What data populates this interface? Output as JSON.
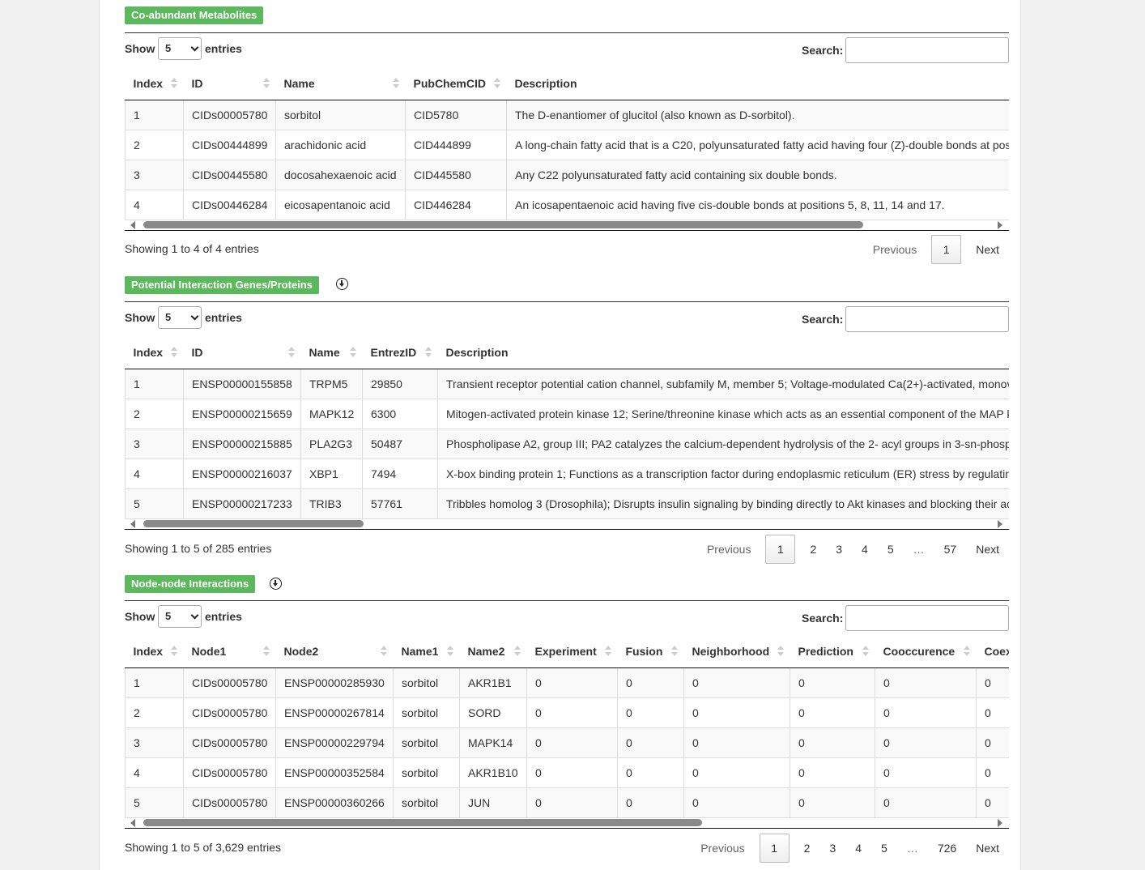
{
  "common": {
    "show_label": "Show",
    "entries_label": "entries",
    "page_size": "5",
    "search_label": "Search:",
    "previous": "Previous",
    "next": "Next"
  },
  "sections": {
    "metabolites": {
      "title": "Co-abundant Metabolites",
      "columns": [
        "Index",
        "ID",
        "Name",
        "PubChemCID",
        "Description"
      ],
      "rows": [
        [
          "1",
          "CIDs00005780",
          "sorbitol",
          "CID5780",
          "The D-enantiomer of glucitol (also known as D-sorbitol)."
        ],
        [
          "2",
          "CIDs00444899",
          "arachidonic acid",
          "CID444899",
          "A long-chain fatty acid that is a C20, polyunsaturated fatty acid having four (Z)-double bonds at pos"
        ],
        [
          "3",
          "CIDs00445580",
          "docosahexaenoic acid",
          "CID445580",
          "Any C22 polyunsaturated fatty acid containing six double bonds."
        ],
        [
          "4",
          "CIDs00446284",
          "eicosapentanoic acid",
          "CID446284",
          "An icosapentaenoic acid having five cis-double bonds at positions 5, 8, 11, 14 and 17."
        ]
      ],
      "info": "Showing 1 to 4 of 4 entries",
      "pages": [
        "1"
      ],
      "scroll_fraction": 0.85
    },
    "genes": {
      "title": "Potential Interaction Genes/Proteins",
      "columns": [
        "Index",
        "ID",
        "Name",
        "EntrezID",
        "Description"
      ],
      "rows": [
        [
          "1",
          "ENSP00000155858",
          "TRPM5",
          "29850",
          "Transient receptor potential cation channel, subfamily M, member 5; Voltage-modulated Ca(2+)-activated, monov"
        ],
        [
          "2",
          "ENSP00000215659",
          "MAPK12",
          "6300",
          "Mitogen-activated protein kinase 12; Serine/threonine kinase which acts as an essential component of the MAP k"
        ],
        [
          "3",
          "ENSP00000215885",
          "PLA2G3",
          "50487",
          "Phospholipase A2, group III; PA2 catalyzes the calcium-dependent hydrolysis of the 2- acyl groups in 3-sn-phosp"
        ],
        [
          "4",
          "ENSP00000216037",
          "XBP1",
          "7494",
          "X-box binding protein 1; Functions as a transcription factor during endoplasmic reticulum (ER) stress by regulatin"
        ],
        [
          "5",
          "ENSP00000217233",
          "TRIB3",
          "57761",
          "Tribbles homolog 3 (Drosophila); Disrupts insulin signaling by binding directly to Akt kinases and blocking their ac"
        ]
      ],
      "info": "Showing 1 to 5 of 285 entries",
      "pages": [
        "1",
        "2",
        "3",
        "4",
        "5",
        "…",
        "57"
      ],
      "scroll_fraction": 0.26
    },
    "interactions": {
      "title": "Node-node Interactions",
      "columns": [
        "Index",
        "Node1",
        "Node2",
        "Name1",
        "Name2",
        "Experiment",
        "Fusion",
        "Neighborhood",
        "Prediction",
        "Cooccurence",
        "Coex"
      ],
      "rows": [
        [
          "1",
          "CIDs00005780",
          "ENSP00000285930",
          "sorbitol",
          "AKR1B1",
          "0",
          "0",
          "0",
          "0",
          "0",
          "0"
        ],
        [
          "2",
          "CIDs00005780",
          "ENSP00000267814",
          "sorbitol",
          "SORD",
          "0",
          "0",
          "0",
          "0",
          "0",
          "0"
        ],
        [
          "3",
          "CIDs00005780",
          "ENSP00000229794",
          "sorbitol",
          "MAPK14",
          "0",
          "0",
          "0",
          "0",
          "0",
          "0"
        ],
        [
          "4",
          "CIDs00005780",
          "ENSP00000352584",
          "sorbitol",
          "AKR1B10",
          "0",
          "0",
          "0",
          "0",
          "0",
          "0"
        ],
        [
          "5",
          "CIDs00005780",
          "ENSP00000360266",
          "sorbitol",
          "JUN",
          "0",
          "0",
          "0",
          "0",
          "0",
          "0"
        ]
      ],
      "info": "Showing 1 to 5 of 3,629 entries",
      "pages": [
        "1",
        "2",
        "3",
        "4",
        "5",
        "…",
        "726"
      ],
      "scroll_fraction": 0.66
    }
  }
}
